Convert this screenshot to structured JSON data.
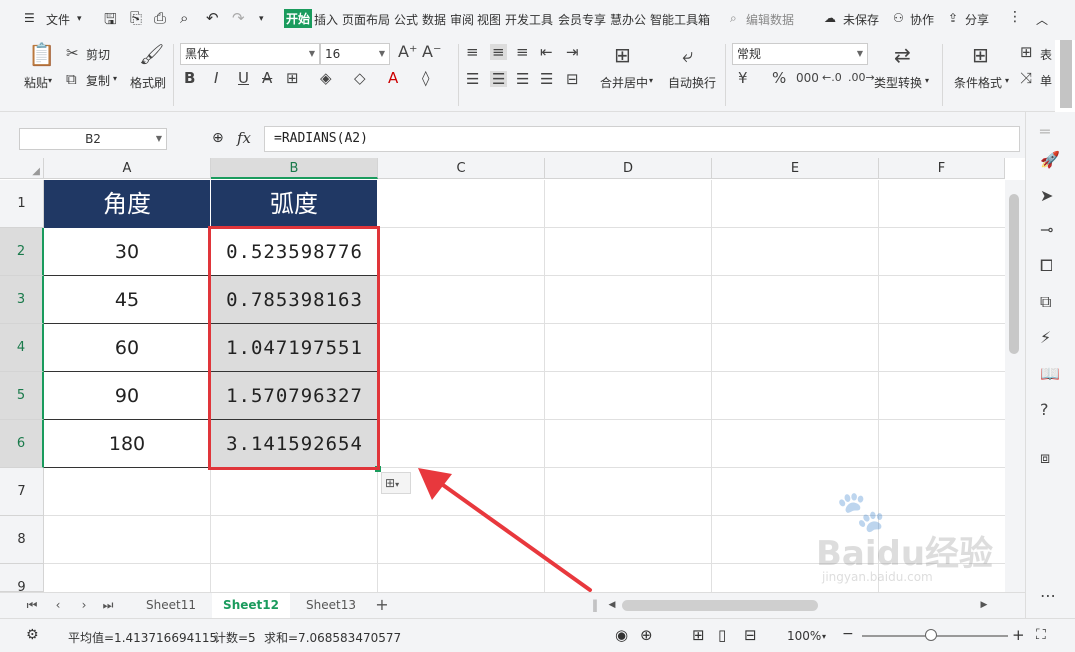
{
  "menu": {
    "file": "文件",
    "tabs": [
      "开始",
      "插入",
      "页面布局",
      "公式",
      "数据",
      "审阅",
      "视图",
      "开发工具",
      "会员专享",
      "慧办公",
      "智能工具箱"
    ],
    "active_tab": "开始",
    "search": "编辑数据",
    "unsaved": "未保存",
    "collab": "协作",
    "share": "分享"
  },
  "ribbon": {
    "paste": "粘贴",
    "cut": "剪切",
    "copy": "复制",
    "format_painter": "格式刷",
    "font_name": "黑体",
    "font_size": "16",
    "merge_center": "合并居中",
    "wrap_text": "自动换行",
    "number_format": "常规",
    "type_convert": "类型转换",
    "cond_format": "条件格式",
    "table_partial": "表",
    "cell_partial": "单"
  },
  "formula_bar": {
    "name_box": "B2",
    "fx": "fx",
    "formula": "=RADIANS(A2)"
  },
  "columns": [
    "A",
    "B",
    "C",
    "D",
    "E",
    "F"
  ],
  "rows": [
    "1",
    "2",
    "3",
    "4",
    "5",
    "6",
    "7",
    "8",
    "9"
  ],
  "table": {
    "header": [
      "角度",
      "弧度"
    ],
    "data": [
      [
        "30",
        "0.523598776"
      ],
      [
        "45",
        "0.785398163"
      ],
      [
        "60",
        "1.047197551"
      ],
      [
        "90",
        "1.570796327"
      ],
      [
        "180",
        "3.141592654"
      ]
    ]
  },
  "sheets": [
    "Sheet11",
    "Sheet12",
    "Sheet13"
  ],
  "active_sheet": "Sheet12",
  "status": {
    "average": "平均值=1.413716694115",
    "count": "计数=5",
    "sum": "求和=7.068583470577",
    "zoom": "100%"
  },
  "watermark": {
    "brand": "Baidu经验",
    "url": "jingyan.baidu.com"
  },
  "colors": {
    "header_fill": "#203864",
    "selection": "#e0353a",
    "accent": "#1a9b5d"
  }
}
